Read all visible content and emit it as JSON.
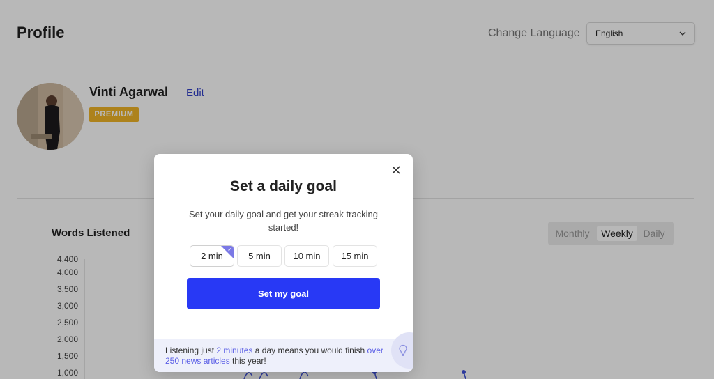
{
  "header": {
    "title": "Profile",
    "change_language_label": "Change Language",
    "language_value": "English"
  },
  "user": {
    "name": "Vinti Agarwal",
    "edit_label": "Edit",
    "badge": "PREMIUM"
  },
  "chart_section": {
    "title": "Words Listened",
    "periods": [
      "Monthly",
      "Weekly",
      "Daily"
    ],
    "active_period": "Weekly"
  },
  "chart_data": {
    "type": "line",
    "title": "Words Listened",
    "xlabel": "",
    "ylabel": "",
    "yticks": [
      "4,400",
      "4,000",
      "3,500",
      "3,000",
      "2,500",
      "2,000",
      "1,500",
      "1,000"
    ],
    "ylim": [
      1000,
      4400
    ],
    "visible_point_values": [
      1000,
      1000
    ],
    "grid": false,
    "series_color": "#3f51d8"
  },
  "modal": {
    "title": "Set a daily goal",
    "description": "Set your daily goal and get your streak tracking started!",
    "goal_options": [
      "2 min",
      "5 min",
      "10 min",
      "15 min"
    ],
    "selected_goal": "2 min",
    "cta_label": "Set my goal",
    "footer": {
      "prefix": "Listening just ",
      "highlight1": "2 minutes",
      "middle": " a day means you would finish ",
      "highlight2": "over 250 news articles",
      "suffix": " this year!"
    },
    "close_icon": "close-icon",
    "tip_icon": "lightbulb-icon"
  },
  "colors": {
    "accent": "#2839f5",
    "premium": "#f0b428",
    "link": "#3340c8",
    "highlight": "#5b5fe6"
  }
}
